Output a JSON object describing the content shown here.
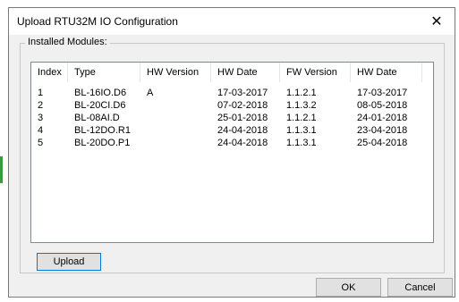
{
  "window": {
    "title": "Upload RTU32M IO Configuration",
    "close_glyph": "✕"
  },
  "modules_group": {
    "label": "Installed Modules:"
  },
  "table": {
    "columns": [
      "Index",
      "Type",
      "HW Version",
      "HW Date",
      "FW Version",
      "HW Date"
    ],
    "rows": [
      [
        "1",
        "BL-16IO.D6",
        "A",
        "17-03-2017",
        "1.1.2.1",
        "17-03-2017"
      ],
      [
        "2",
        "BL-20CI.D6",
        "",
        "07-02-2018",
        "1.1.3.2",
        "08-05-2018"
      ],
      [
        "3",
        "BL-08AI.D",
        "",
        "25-01-2018",
        "1.1.2.1",
        "24-01-2018"
      ],
      [
        "4",
        "BL-12DO.R1",
        "",
        "24-04-2018",
        "1.1.3.1",
        "23-04-2018"
      ],
      [
        "5",
        "BL-20DO.P1",
        "",
        "24-04-2018",
        "1.1.3.1",
        "25-04-2018"
      ]
    ]
  },
  "buttons": {
    "upload": "Upload",
    "ok": "OK",
    "cancel": "Cancel"
  },
  "colors": {
    "focus_border": "#0078d7",
    "dialog_bg": "#f0f0f0"
  }
}
